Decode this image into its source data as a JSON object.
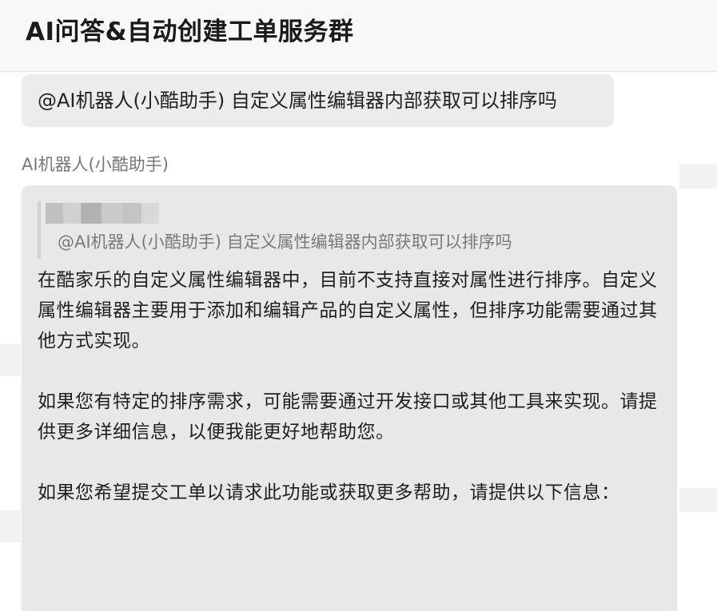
{
  "header": {
    "title": "AI问答&自动创建工单服务群"
  },
  "messages": {
    "user_message": "@AI机器人(小酷助手) 自定义属性编辑器内部获取可以排序吗",
    "bot_name": "AI机器人(小酷助手)",
    "bot_reply": {
      "quote_text": "@AI机器人(小酷助手)  自定义属性编辑器内部获取可以排序吗",
      "paragraphs": [
        " 在酷家乐的自定义属性编辑器中，目前不支持直接对属性进行排序。自定义属性编辑器主要用于添加和编辑产品的自定义属性，但排序功能需要通过其他方式实现。",
        "如果您有特定的排序需求，可能需要通过开发接口或其他工具来实现。请提供更多详细信息，以便我能更好地帮助您。",
        "如果您希望提交工单以请求此功能或获取更多帮助，请提供以下信息："
      ]
    }
  }
}
